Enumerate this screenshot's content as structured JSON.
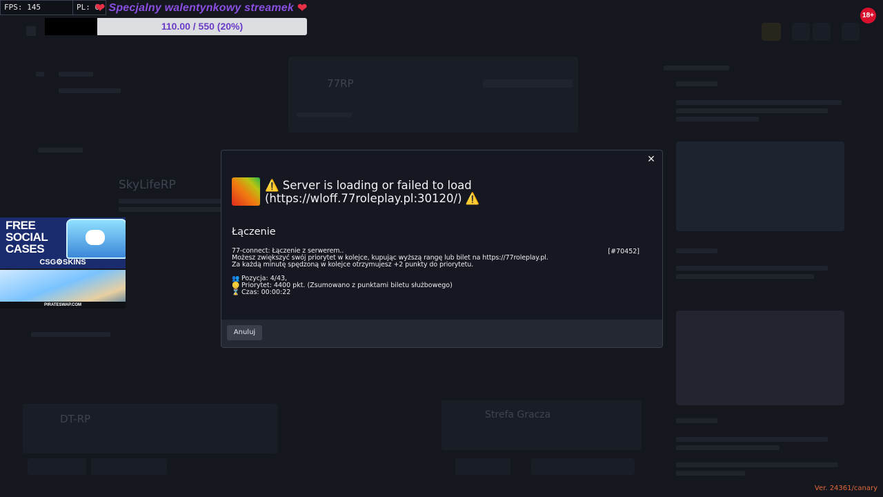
{
  "overlay": {
    "fps_label": "FPS: 145",
    "pl_label": "PL: 0",
    "stream_title": "Specjalny walentynkowy streamek",
    "goal_text": "110.00 / 550 (20%)",
    "goal_progress": 0.2,
    "age_badge": "18+"
  },
  "ads": {
    "csgo_headline": "FREE SOCIAL CASES",
    "csgo_brand": "CSG⚙SKINS",
    "pirate_brand": "PIRATESWAP.COM"
  },
  "background_app": {
    "server_card_name": "77RP",
    "server_card_name_2": "SkyLifeRP",
    "server_card_name_3": "DT-RP",
    "server_card_name_4": "Strefa Gracza"
  },
  "modal": {
    "close_glyph": "✕",
    "warn_glyph": "⚠️",
    "title_line1": "Server is loading or failed to load",
    "title_line2": "(https://wloff.77roleplay.pl:30120/)",
    "section_title": "Łączenie",
    "message_line1": "77-connect: Łączenie z serwerem..",
    "message_line2": "Możesz zwiększyć swój priorytet w kolejce, kupując wyższą rangę lub bilet na https://77roleplay.pl.",
    "message_line3": "Za każdą minutę spędzoną w kolejce otrzymujesz +2 punkty do priorytetu.",
    "message_id": "[#70452]",
    "position_text": "Pozycja: 4/43,",
    "priority_text": "Priorytet: 4400 pkt. (Zsumowano z punktami biletu służbowego)",
    "time_text": "Czas: 00:00:22",
    "cancel_label": "Anuluj"
  },
  "footer": {
    "version": "Ver. 24361/canary"
  },
  "colors": {
    "background": "#1b1e26",
    "modal": "#151820",
    "accent_purple": "#8a4fe0",
    "heart_red": "#e53048",
    "version_orange": "#e0683a",
    "warning_yellow": "#f5b21e"
  }
}
